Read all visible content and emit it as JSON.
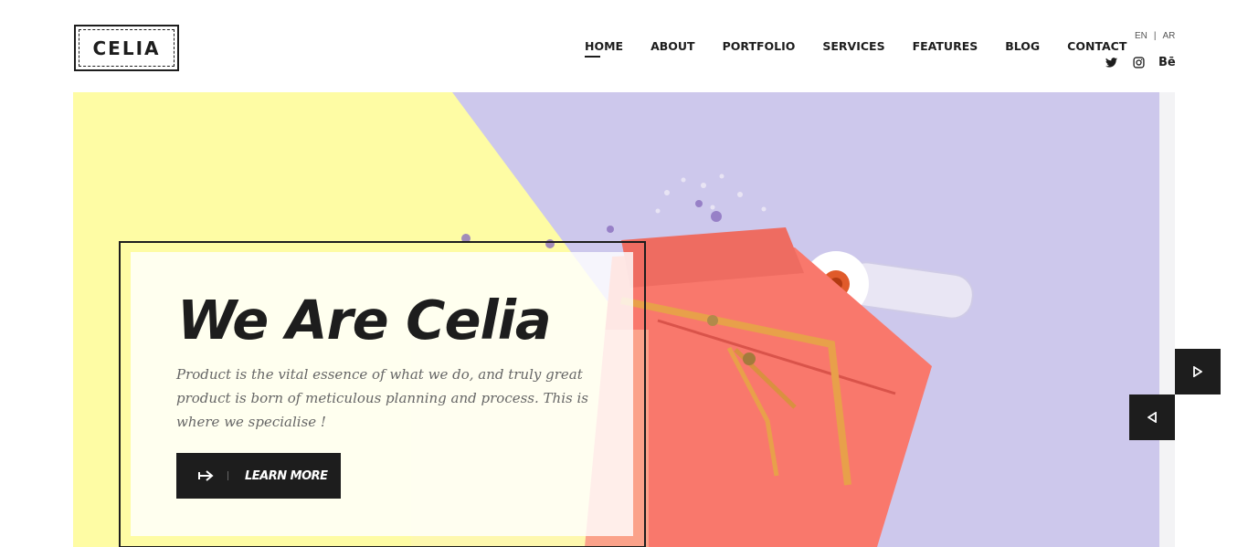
{
  "brand": {
    "logo_text": "CELIA"
  },
  "nav": {
    "items": [
      {
        "label": "HOME",
        "active": true
      },
      {
        "label": "ABOUT"
      },
      {
        "label": "PORTFOLIO"
      },
      {
        "label": "SERVICES"
      },
      {
        "label": "FEATURES"
      },
      {
        "label": "BLOG"
      },
      {
        "label": "CONTACT"
      }
    ]
  },
  "language": {
    "en": "EN",
    "separator": "|",
    "ar": "AR"
  },
  "social": {
    "icons": [
      "twitter-icon",
      "instagram-icon",
      "behance-icon"
    ],
    "behance_label": "Bē"
  },
  "hero": {
    "title": "We Are Celia",
    "description": "Product is the vital essence of what we do, and truly great product is born of meticulous planning and process. This is where we specialise !",
    "button_label": "LEARN MORE",
    "button_icon": "arrow-right-icon"
  },
  "slider": {
    "next_icon": "play-right-icon",
    "prev_icon": "play-left-icon"
  },
  "colors": {
    "dark": "#1d1d1d",
    "yellow": "#fefca4",
    "lavender": "#cdc8ec",
    "bag": "#f9786c"
  }
}
